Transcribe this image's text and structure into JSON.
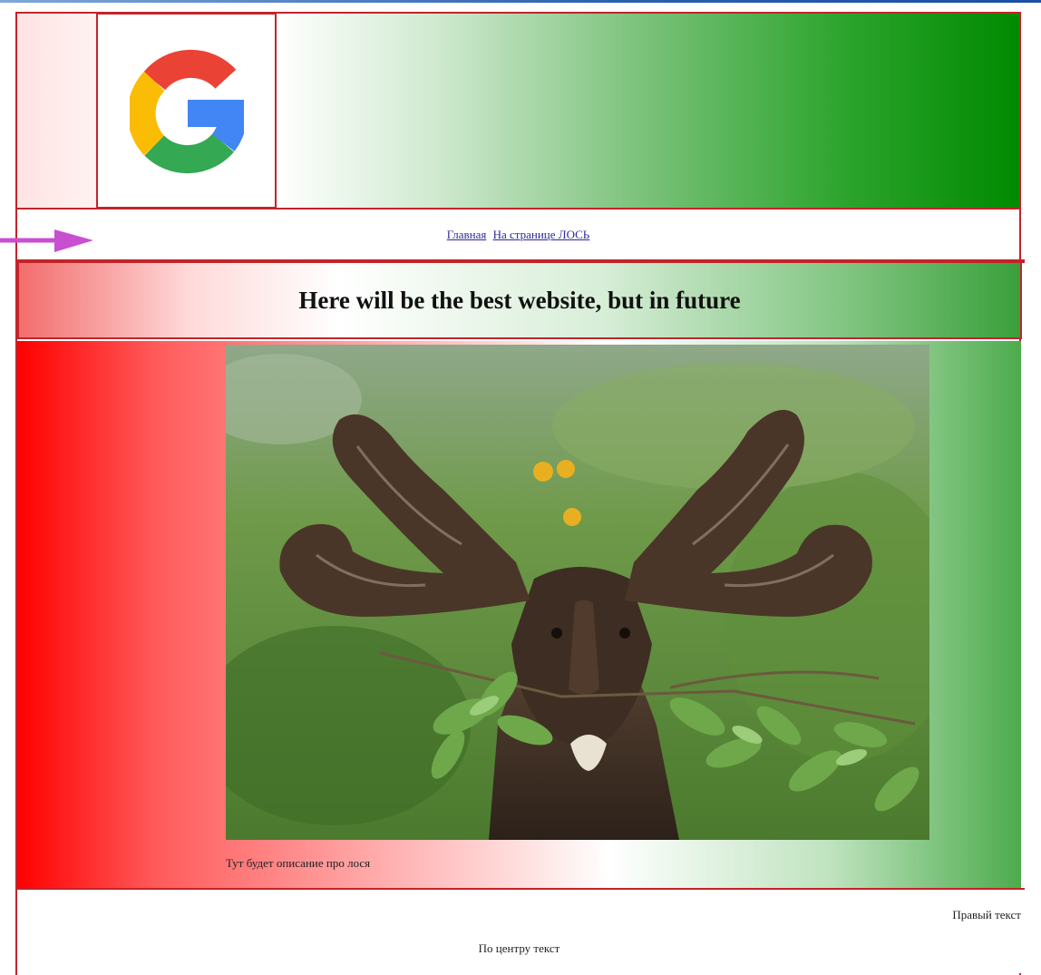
{
  "nav": {
    "links": [
      "Главная",
      "На странице ЛОСЬ"
    ]
  },
  "hero": {
    "title": "Here will be the best website, but in future"
  },
  "main": {
    "caption": "Тут будет описание про лося"
  },
  "footer": {
    "right_text": "Правый текст",
    "center_text": "По центру текст"
  },
  "icons": {
    "logo": "google-g-logo",
    "annotation": "arrow-right-icon"
  },
  "colors": {
    "border": "#c2242a",
    "gradient_red": "#ff0000",
    "gradient_green": "#008a00",
    "arrow": "#c84fd0"
  }
}
